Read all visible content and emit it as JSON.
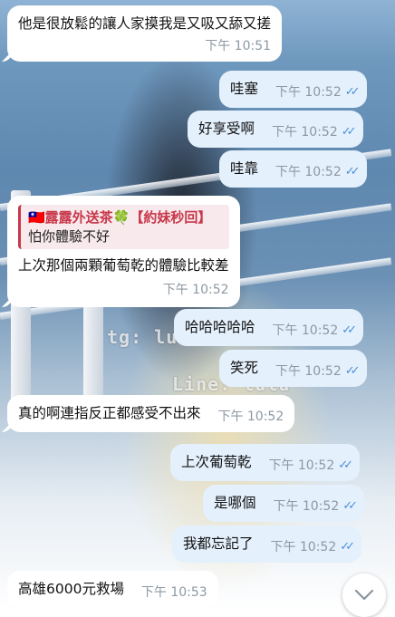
{
  "messages": [
    {
      "id": "m1",
      "dir": "in",
      "text": "他是很放鬆的讓人家摸我是又吸又舔又搓",
      "time": "下午 10:51"
    },
    {
      "id": "m2",
      "dir": "out",
      "text": "哇塞",
      "time": "下午 10:52"
    },
    {
      "id": "m3",
      "dir": "out",
      "text": "好享受啊",
      "time": "下午 10:52"
    },
    {
      "id": "m4",
      "dir": "out",
      "text": "哇靠",
      "time": "下午 10:52"
    },
    {
      "id": "m5",
      "dir": "in",
      "quote_title": "🇹🇼露露外送茶🍀【約妹秒回】",
      "quote_text": "怕你體驗不好",
      "text": "上次那個兩顆葡萄乾的體驗比較差",
      "time": "下午 10:52"
    },
    {
      "id": "m6",
      "dir": "out",
      "text": "哈哈哈哈哈",
      "time": "下午 10:52"
    },
    {
      "id": "m7",
      "dir": "out",
      "text": "笑死",
      "time": "下午 10:52"
    },
    {
      "id": "m8",
      "dir": "in",
      "text": "真的啊連指反正都感受不出來",
      "time": "下午 10:52"
    },
    {
      "id": "m9",
      "dir": "out",
      "text": "上次葡萄乾",
      "time": "下午 10:52"
    },
    {
      "id": "m10",
      "dir": "out",
      "text": "是哪個",
      "time": "下午 10:52"
    },
    {
      "id": "m11",
      "dir": "out",
      "text": "我都忘記了",
      "time": "下午 10:52"
    },
    {
      "id": "m12",
      "dir": "in",
      "text": "高雄6000元救場",
      "time": "下午 10:53"
    }
  ],
  "background": {
    "watermarks": [
      "tg: lulu",
      "Line: lulu"
    ]
  },
  "read_receipt_icon": "double-check-icon",
  "scroll_button_icon": "chevron-down-icon",
  "colors": {
    "incoming_bubble": "#ffffff",
    "outgoing_bubble": "#e4f0fc",
    "time_text": "#8d98a3",
    "read_check": "#4c90d8",
    "quote_accent": "#c8374a"
  }
}
